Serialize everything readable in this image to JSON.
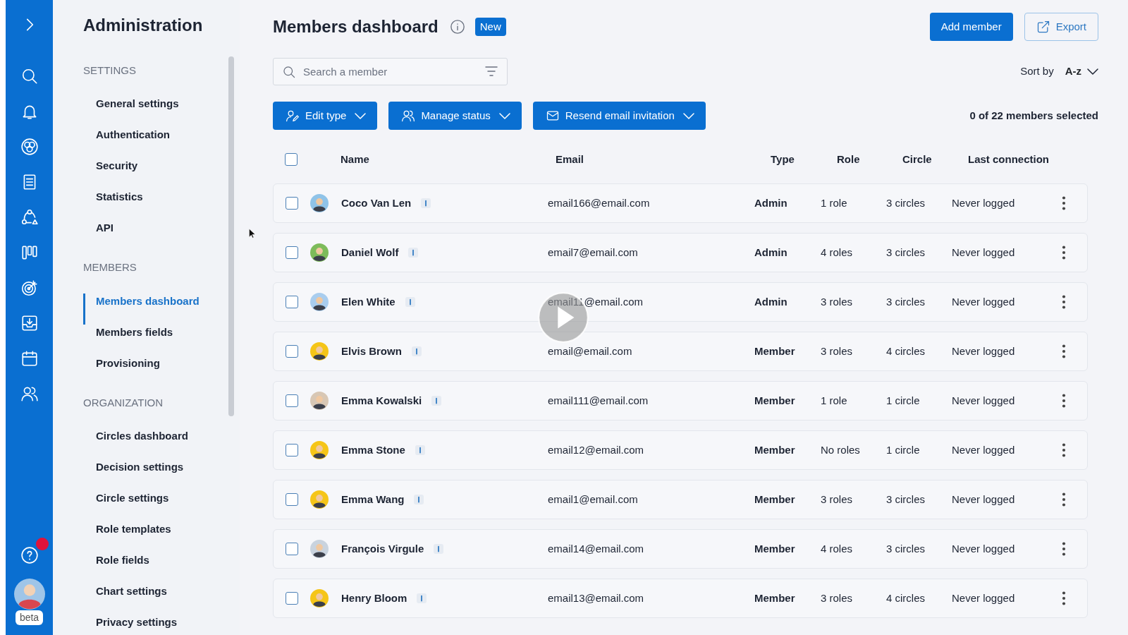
{
  "rail": {
    "help_notification": true,
    "avatar_label": "beta"
  },
  "sidebar": {
    "title": "Administration",
    "sections": [
      {
        "heading": "SETTINGS",
        "items": [
          {
            "label": "General settings",
            "selected": false
          },
          {
            "label": "Authentication",
            "selected": false
          },
          {
            "label": "Security",
            "selected": false
          },
          {
            "label": "Statistics",
            "selected": false
          },
          {
            "label": "API",
            "selected": false
          }
        ]
      },
      {
        "heading": "MEMBERS",
        "items": [
          {
            "label": "Members dashboard",
            "selected": true
          },
          {
            "label": "Members fields",
            "selected": false
          },
          {
            "label": "Provisioning",
            "selected": false
          }
        ]
      },
      {
        "heading": "ORGANIZATION",
        "items": [
          {
            "label": "Circles dashboard",
            "selected": false
          },
          {
            "label": "Decision settings",
            "selected": false
          },
          {
            "label": "Circle settings",
            "selected": false
          },
          {
            "label": "Role templates",
            "selected": false
          },
          {
            "label": "Role fields",
            "selected": false
          },
          {
            "label": "Chart settings",
            "selected": false
          },
          {
            "label": "Privacy settings",
            "selected": false
          }
        ]
      }
    ]
  },
  "header": {
    "title": "Members dashboard",
    "badge": "New",
    "add_button": "Add member",
    "export_button": "Export"
  },
  "search": {
    "placeholder": "Search a member"
  },
  "sort": {
    "label": "Sort by",
    "value": "A-z"
  },
  "actions": [
    {
      "label": "Edit type",
      "kind": "edit"
    },
    {
      "label": "Manage status",
      "kind": "status"
    },
    {
      "label": "Resend email invitation",
      "kind": "email"
    }
  ],
  "selection_count": "0 of 22 members selected",
  "table": {
    "columns": [
      "Name",
      "Email",
      "Type",
      "Role",
      "Circle",
      "Last connection"
    ],
    "all_checked": false,
    "rows": [
      {
        "name": "Coco Van Len",
        "email": "email166@email.com",
        "type": "Admin",
        "role": "1 role",
        "circle": "3 circles",
        "last_connection": "Never logged",
        "checked": false,
        "color": "#8fc3e8"
      },
      {
        "name": "Daniel Wolf",
        "email": "email7@email.com",
        "type": "Admin",
        "role": "4 roles",
        "circle": "3 circles",
        "last_connection": "Never logged",
        "checked": false,
        "color": "#7dbb5a"
      },
      {
        "name": "Elen White",
        "email": "email11@email.com",
        "type": "Admin",
        "role": "3 roles",
        "circle": "3 circles",
        "last_connection": "Never logged",
        "checked": false,
        "color": "#a9cdee"
      },
      {
        "name": "Elvis Brown",
        "email": "email@email.com",
        "type": "Member",
        "role": "3 roles",
        "circle": "4 circles",
        "last_connection": "Never logged",
        "checked": false,
        "color": "#f5c518"
      },
      {
        "name": "Emma Kowalski",
        "email": "email111@email.com",
        "type": "Member",
        "role": "1 role",
        "circle": "1 circle",
        "last_connection": "Never logged",
        "checked": false,
        "color": "#d8c7b4"
      },
      {
        "name": "Emma Stone",
        "email": "email12@email.com",
        "type": "Member",
        "role": "No roles",
        "circle": "1 circle",
        "last_connection": "Never logged",
        "checked": false,
        "color": "#f5c518"
      },
      {
        "name": "Emma Wang",
        "email": "email1@email.com",
        "type": "Member",
        "role": "3 roles",
        "circle": "3 circles",
        "last_connection": "Never logged",
        "checked": false,
        "color": "#f5c518"
      },
      {
        "name": "François Virgule",
        "email": "email14@email.com",
        "type": "Member",
        "role": "4 roles",
        "circle": "3 circles",
        "last_connection": "Never logged",
        "checked": false,
        "color": "#c9d3de"
      },
      {
        "name": "Henry Bloom",
        "email": "email13@email.com",
        "type": "Member",
        "role": "3 roles",
        "circle": "4 circles",
        "last_connection": "Never logged",
        "checked": false,
        "color": "#f5c518"
      }
    ]
  }
}
